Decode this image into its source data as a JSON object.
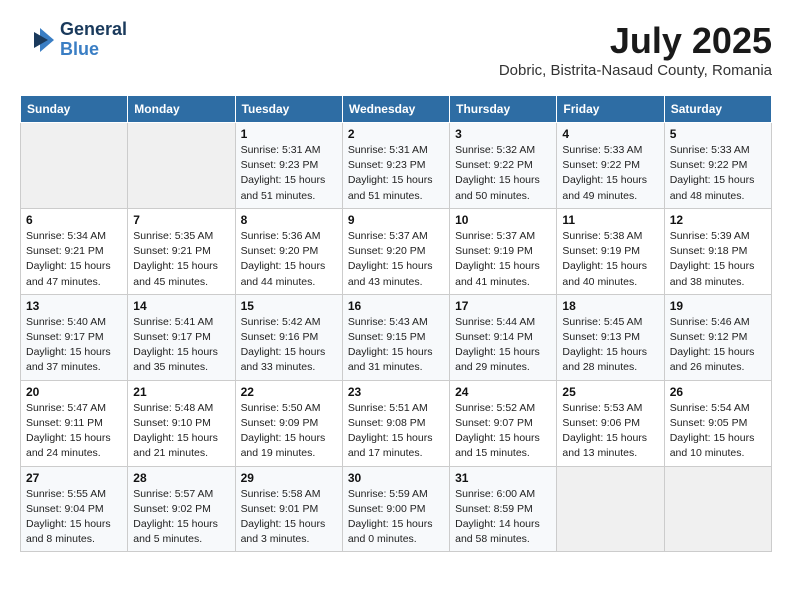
{
  "header": {
    "logo": {
      "line1": "General",
      "line2": "Blue"
    },
    "month": "July 2025",
    "location": "Dobric, Bistrita-Nasaud County, Romania"
  },
  "columns": [
    "Sunday",
    "Monday",
    "Tuesday",
    "Wednesday",
    "Thursday",
    "Friday",
    "Saturday"
  ],
  "weeks": [
    [
      {
        "day": "",
        "detail": ""
      },
      {
        "day": "",
        "detail": ""
      },
      {
        "day": "1",
        "detail": "Sunrise: 5:31 AM\nSunset: 9:23 PM\nDaylight: 15 hours\nand 51 minutes."
      },
      {
        "day": "2",
        "detail": "Sunrise: 5:31 AM\nSunset: 9:23 PM\nDaylight: 15 hours\nand 51 minutes."
      },
      {
        "day": "3",
        "detail": "Sunrise: 5:32 AM\nSunset: 9:22 PM\nDaylight: 15 hours\nand 50 minutes."
      },
      {
        "day": "4",
        "detail": "Sunrise: 5:33 AM\nSunset: 9:22 PM\nDaylight: 15 hours\nand 49 minutes."
      },
      {
        "day": "5",
        "detail": "Sunrise: 5:33 AM\nSunset: 9:22 PM\nDaylight: 15 hours\nand 48 minutes."
      }
    ],
    [
      {
        "day": "6",
        "detail": "Sunrise: 5:34 AM\nSunset: 9:21 PM\nDaylight: 15 hours\nand 47 minutes."
      },
      {
        "day": "7",
        "detail": "Sunrise: 5:35 AM\nSunset: 9:21 PM\nDaylight: 15 hours\nand 45 minutes."
      },
      {
        "day": "8",
        "detail": "Sunrise: 5:36 AM\nSunset: 9:20 PM\nDaylight: 15 hours\nand 44 minutes."
      },
      {
        "day": "9",
        "detail": "Sunrise: 5:37 AM\nSunset: 9:20 PM\nDaylight: 15 hours\nand 43 minutes."
      },
      {
        "day": "10",
        "detail": "Sunrise: 5:37 AM\nSunset: 9:19 PM\nDaylight: 15 hours\nand 41 minutes."
      },
      {
        "day": "11",
        "detail": "Sunrise: 5:38 AM\nSunset: 9:19 PM\nDaylight: 15 hours\nand 40 minutes."
      },
      {
        "day": "12",
        "detail": "Sunrise: 5:39 AM\nSunset: 9:18 PM\nDaylight: 15 hours\nand 38 minutes."
      }
    ],
    [
      {
        "day": "13",
        "detail": "Sunrise: 5:40 AM\nSunset: 9:17 PM\nDaylight: 15 hours\nand 37 minutes."
      },
      {
        "day": "14",
        "detail": "Sunrise: 5:41 AM\nSunset: 9:17 PM\nDaylight: 15 hours\nand 35 minutes."
      },
      {
        "day": "15",
        "detail": "Sunrise: 5:42 AM\nSunset: 9:16 PM\nDaylight: 15 hours\nand 33 minutes."
      },
      {
        "day": "16",
        "detail": "Sunrise: 5:43 AM\nSunset: 9:15 PM\nDaylight: 15 hours\nand 31 minutes."
      },
      {
        "day": "17",
        "detail": "Sunrise: 5:44 AM\nSunset: 9:14 PM\nDaylight: 15 hours\nand 29 minutes."
      },
      {
        "day": "18",
        "detail": "Sunrise: 5:45 AM\nSunset: 9:13 PM\nDaylight: 15 hours\nand 28 minutes."
      },
      {
        "day": "19",
        "detail": "Sunrise: 5:46 AM\nSunset: 9:12 PM\nDaylight: 15 hours\nand 26 minutes."
      }
    ],
    [
      {
        "day": "20",
        "detail": "Sunrise: 5:47 AM\nSunset: 9:11 PM\nDaylight: 15 hours\nand 24 minutes."
      },
      {
        "day": "21",
        "detail": "Sunrise: 5:48 AM\nSunset: 9:10 PM\nDaylight: 15 hours\nand 21 minutes."
      },
      {
        "day": "22",
        "detail": "Sunrise: 5:50 AM\nSunset: 9:09 PM\nDaylight: 15 hours\nand 19 minutes."
      },
      {
        "day": "23",
        "detail": "Sunrise: 5:51 AM\nSunset: 9:08 PM\nDaylight: 15 hours\nand 17 minutes."
      },
      {
        "day": "24",
        "detail": "Sunrise: 5:52 AM\nSunset: 9:07 PM\nDaylight: 15 hours\nand 15 minutes."
      },
      {
        "day": "25",
        "detail": "Sunrise: 5:53 AM\nSunset: 9:06 PM\nDaylight: 15 hours\nand 13 minutes."
      },
      {
        "day": "26",
        "detail": "Sunrise: 5:54 AM\nSunset: 9:05 PM\nDaylight: 15 hours\nand 10 minutes."
      }
    ],
    [
      {
        "day": "27",
        "detail": "Sunrise: 5:55 AM\nSunset: 9:04 PM\nDaylight: 15 hours\nand 8 minutes."
      },
      {
        "day": "28",
        "detail": "Sunrise: 5:57 AM\nSunset: 9:02 PM\nDaylight: 15 hours\nand 5 minutes."
      },
      {
        "day": "29",
        "detail": "Sunrise: 5:58 AM\nSunset: 9:01 PM\nDaylight: 15 hours\nand 3 minutes."
      },
      {
        "day": "30",
        "detail": "Sunrise: 5:59 AM\nSunset: 9:00 PM\nDaylight: 15 hours\nand 0 minutes."
      },
      {
        "day": "31",
        "detail": "Sunrise: 6:00 AM\nSunset: 8:59 PM\nDaylight: 14 hours\nand 58 minutes."
      },
      {
        "day": "",
        "detail": ""
      },
      {
        "day": "",
        "detail": ""
      }
    ]
  ]
}
